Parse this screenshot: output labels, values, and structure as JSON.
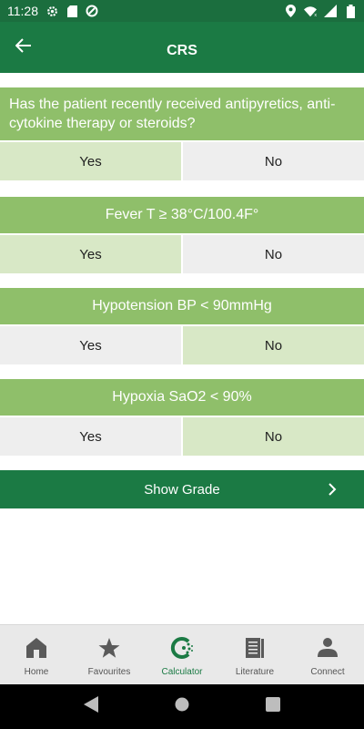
{
  "status_bar": {
    "time": "11:28"
  },
  "app_bar": {
    "title": "CRS"
  },
  "questions": [
    {
      "text": "Has the patient recently received antipyretics, anti-cytokine therapy or steroids?",
      "yes": "Yes",
      "no": "No",
      "selected": "Yes"
    },
    {
      "text": "Fever T ≥ 38°C/100.4F°",
      "yes": "Yes",
      "no": "No",
      "selected": "Yes"
    },
    {
      "text": "Hypotension BP < 90mmHg",
      "yes": "Yes",
      "no": "No",
      "selected": "No"
    },
    {
      "text": "Hypoxia SaO2 < 90%",
      "yes": "Yes",
      "no": "No",
      "selected": "No"
    }
  ],
  "grade_button": {
    "label": "Show Grade"
  },
  "bottom_nav": [
    {
      "label": "Home",
      "icon": "home-icon",
      "active": false
    },
    {
      "label": "Favourites",
      "icon": "star-icon",
      "active": false
    },
    {
      "label": "Calculator",
      "icon": "calculator-icon",
      "active": true
    },
    {
      "label": "Literature",
      "icon": "book-icon",
      "active": false
    },
    {
      "label": "Connect",
      "icon": "person-icon",
      "active": false
    }
  ],
  "colors": {
    "primary": "#1b7a44",
    "status": "#1b6e3e",
    "accent_light": "#8fbf6a",
    "selected": "#d8e8c6",
    "unselected": "#eeeeee"
  }
}
